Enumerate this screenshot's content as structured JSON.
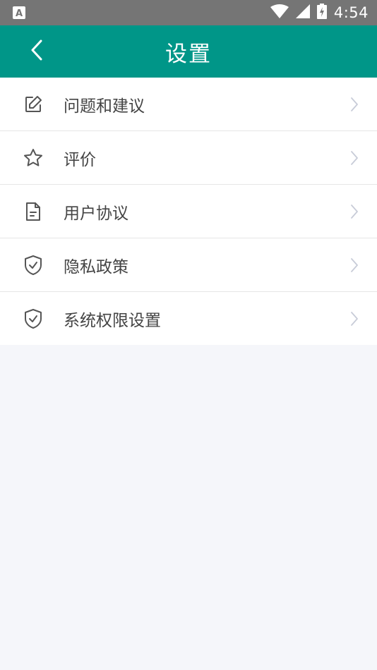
{
  "status_bar": {
    "time": "4:54",
    "left_icon": "a-icon",
    "icons": [
      "wifi-icon",
      "signal-icon",
      "battery-charging-icon"
    ]
  },
  "app_bar": {
    "title": "设置",
    "back_icon": "back-arrow-icon",
    "color": "#009688"
  },
  "menu": {
    "items": [
      {
        "label": "问题和建议",
        "icon": "edit-icon"
      },
      {
        "label": "评价",
        "icon": "star-icon"
      },
      {
        "label": "用户协议",
        "icon": "document-icon"
      },
      {
        "label": "隐私政策",
        "icon": "shield-check-icon"
      },
      {
        "label": "系统权限设置",
        "icon": "shield-check-icon"
      }
    ],
    "chevron_icon": "chevron-right-icon"
  }
}
